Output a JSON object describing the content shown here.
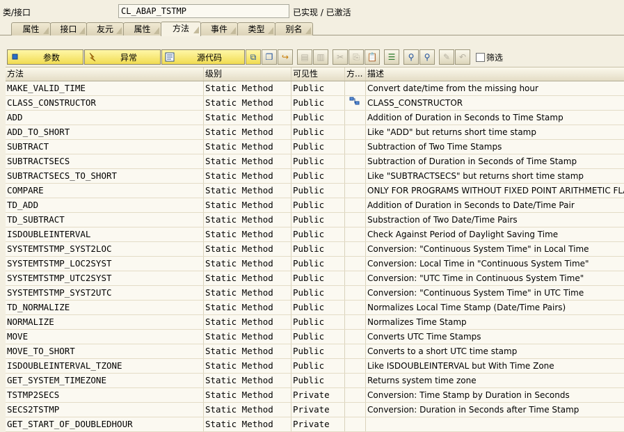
{
  "header": {
    "class_label": "类/接口",
    "class_name": "CL_ABAP_TSTMP",
    "status": "已实现 / 已激活"
  },
  "tabs": [
    {
      "label": "属性",
      "active": false
    },
    {
      "label": "接口",
      "active": false
    },
    {
      "label": "友元",
      "active": false
    },
    {
      "label": "属性",
      "active": false
    },
    {
      "label": "方法",
      "active": true
    },
    {
      "label": "事件",
      "active": false
    },
    {
      "label": "类型",
      "active": false
    },
    {
      "label": "别名",
      "active": false
    }
  ],
  "toolbar": {
    "params_label": "参数",
    "exceptions_label": "异常",
    "source_label": "源代码",
    "filter_label": "筛选"
  },
  "table": {
    "columns": [
      "方法",
      "级别",
      "可见性",
      "方...",
      "描述"
    ],
    "rows": [
      {
        "method": "MAKE_VALID_TIME",
        "level": "Static Method",
        "visibility": "Public",
        "icon": "",
        "description": "Convert date/time from the missing hour"
      },
      {
        "method": "CLASS_CONSTRUCTOR",
        "level": "Static Method",
        "visibility": "Public",
        "icon": "constructor-icon",
        "description": "CLASS_CONSTRUCTOR"
      },
      {
        "method": "ADD",
        "level": "Static Method",
        "visibility": "Public",
        "icon": "",
        "description": "Addition of Duration in Seconds to Time Stamp"
      },
      {
        "method": "ADD_TO_SHORT",
        "level": "Static Method",
        "visibility": "Public",
        "icon": "",
        "description": "Like \"ADD\" but returns short time stamp"
      },
      {
        "method": "SUBTRACT",
        "level": "Static Method",
        "visibility": "Public",
        "icon": "",
        "description": "Subtraction of Two Time Stamps"
      },
      {
        "method": "SUBTRACTSECS",
        "level": "Static Method",
        "visibility": "Public",
        "icon": "",
        "description": "Subtraction of Duration in Seconds of Time Stamp"
      },
      {
        "method": "SUBTRACTSECS_TO_SHORT",
        "level": "Static Method",
        "visibility": "Public",
        "icon": "",
        "description": "Like \"SUBTRACTSECS\" but returns short time stamp"
      },
      {
        "method": "COMPARE",
        "level": "Static Method",
        "visibility": "Public",
        "icon": "",
        "description": "ONLY FOR PROGRAMS WITHOUT FIXED POINT ARITHMETIC FLAG"
      },
      {
        "method": "TD_ADD",
        "level": "Static Method",
        "visibility": "Public",
        "icon": "",
        "description": "Addition of Duration in Seconds to Date/Time Pair"
      },
      {
        "method": "TD_SUBTRACT",
        "level": "Static Method",
        "visibility": "Public",
        "icon": "",
        "description": "Substraction of Two Date/Time Pairs"
      },
      {
        "method": "ISDOUBLEINTERVAL",
        "level": "Static Method",
        "visibility": "Public",
        "icon": "",
        "description": "Check Against Period of Daylight Saving Time"
      },
      {
        "method": "SYSTEMTSTMP_SYST2LOC",
        "level": "Static Method",
        "visibility": "Public",
        "icon": "",
        "description": "Conversion: \"Continuous System Time\" in Local Time"
      },
      {
        "method": "SYSTEMTSTMP_LOC2SYST",
        "level": "Static Method",
        "visibility": "Public",
        "icon": "",
        "description": "Conversion: Local Time in \"Continuous System Time\""
      },
      {
        "method": "SYSTEMTSTMP_UTC2SYST",
        "level": "Static Method",
        "visibility": "Public",
        "icon": "",
        "description": "Conversion: \"UTC Time in Continuous System Time\""
      },
      {
        "method": "SYSTEMTSTMP_SYST2UTC",
        "level": "Static Method",
        "visibility": "Public",
        "icon": "",
        "description": "Conversion: \"Continuous System Time\" in UTC Time"
      },
      {
        "method": "TD_NORMALIZE",
        "level": "Static Method",
        "visibility": "Public",
        "icon": "",
        "description": "Normalizes Local Time Stamp (Date/Time Pairs)"
      },
      {
        "method": "NORMALIZE",
        "level": "Static Method",
        "visibility": "Public",
        "icon": "",
        "description": "Normalizes Time Stamp"
      },
      {
        "method": "MOVE",
        "level": "Static Method",
        "visibility": "Public",
        "icon": "",
        "description": "Converts UTC Time Stamps"
      },
      {
        "method": "MOVE_TO_SHORT",
        "level": "Static Method",
        "visibility": "Public",
        "icon": "",
        "description": "Converts to a short UTC time stamp"
      },
      {
        "method": "ISDOUBLEINTERVAL_TZONE",
        "level": "Static Method",
        "visibility": "Public",
        "icon": "",
        "description": "Like ISDOUBLEINTERVAL but With Time Zone"
      },
      {
        "method": "GET_SYSTEM_TIMEZONE",
        "level": "Static Method",
        "visibility": "Public",
        "icon": "",
        "description": "Returns system time zone"
      },
      {
        "method": "TSTMP2SECS",
        "level": "Static Method",
        "visibility": "Private",
        "icon": "",
        "description": "Conversion: Time Stamp by Duration in Seconds"
      },
      {
        "method": "SECS2TSTMP",
        "level": "Static Method",
        "visibility": "Private",
        "icon": "",
        "description": "Conversion: Duration in Seconds after Time Stamp"
      },
      {
        "method": "GET_START_OF_DOUBLEDHOUR",
        "level": "Static Method",
        "visibility": "Private",
        "icon": "",
        "description": ""
      }
    ]
  }
}
